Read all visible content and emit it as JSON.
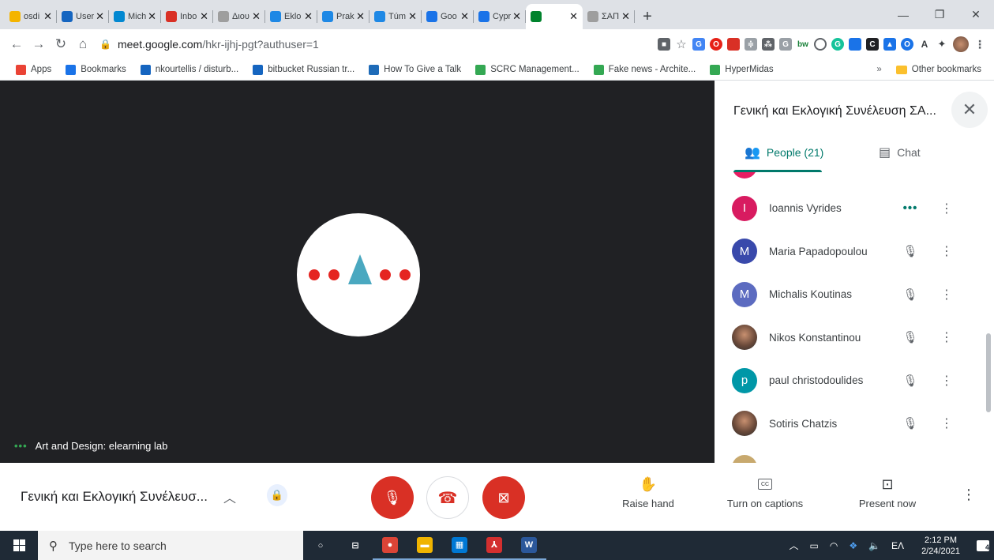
{
  "browser": {
    "tabs": [
      {
        "title": "osdi",
        "color": "#f4b400",
        "active": false
      },
      {
        "title": "User",
        "color": "#1565c0",
        "active": false
      },
      {
        "title": "Mich",
        "color": "#0288d1",
        "active": false
      },
      {
        "title": "Inbo",
        "color": "#d93025",
        "active": false
      },
      {
        "title": "Διου",
        "color": "#9e9e9e",
        "active": false
      },
      {
        "title": "Eklo",
        "color": "#1e88e5",
        "active": false
      },
      {
        "title": "Prak",
        "color": "#1e88e5",
        "active": false
      },
      {
        "title": "Túm",
        "color": "#1e88e5",
        "active": false
      },
      {
        "title": "Goo",
        "color": "#1a73e8",
        "active": false
      },
      {
        "title": "Cypr",
        "color": "#1a73e8",
        "active": false
      },
      {
        "title": "",
        "color": "#00832d",
        "active": true
      },
      {
        "title": "ΣΑΠ",
        "color": "#9e9e9e",
        "active": false
      }
    ],
    "tab_close_glyph": "✕",
    "new_tab_glyph": "+",
    "url_host": "meet.google.com",
    "url_path": "/hkr-ijhj-pgt?authuser=1",
    "bookmarks": [
      {
        "label": "Apps",
        "icon": "apps-icon",
        "color": "#ea4335"
      },
      {
        "label": "Bookmarks",
        "icon": "star-icon",
        "color": "#1a73e8"
      },
      {
        "label": "nkourtellis / disturb...",
        "icon": "bitbucket-icon",
        "color": "#1565c0"
      },
      {
        "label": "bitbucket Russian tr...",
        "icon": "atlassian-icon",
        "color": "#1565c0"
      },
      {
        "label": "How To Give a Talk",
        "icon": "page-icon",
        "color": "#1e6bb8"
      },
      {
        "label": "SCRC Management...",
        "icon": "drive-icon",
        "color": "#34a853"
      },
      {
        "label": "Fake news - Archite...",
        "icon": "drive-icon",
        "color": "#34a853"
      },
      {
        "label": "HyperMidas",
        "icon": "drive-icon",
        "color": "#34a853"
      }
    ],
    "bookmarks_overflow": "»",
    "other_bookmarks": "Other bookmarks"
  },
  "stage": {
    "presenter_label": "Art and Design: elearning lab",
    "talking_indicator": "•••",
    "logo_colors": {
      "dots": "#e52521",
      "triangle": "#4aa8c0"
    }
  },
  "panel": {
    "title": "Γενική και Εκλογική Συνέλευση ΣΑ...",
    "close_glyph": "✕",
    "people_tab": "People (21)",
    "chat_tab": "Chat",
    "accent_color": "#00796b",
    "participants": [
      {
        "name": "Ioannis Vyrides",
        "initial": "I",
        "avatar_color": "#d81b60",
        "photo": false,
        "status": "talking",
        "status_glyph": "•••"
      },
      {
        "name": "Maria Papadopoulou",
        "initial": "M",
        "avatar_color": "#3949ab",
        "photo": false,
        "status": "muted",
        "status_glyph": "🎙"
      },
      {
        "name": "Michalis Koutinas",
        "initial": "M",
        "avatar_color": "#5c6bc0",
        "photo": false,
        "status": "muted",
        "status_glyph": "🎙"
      },
      {
        "name": "Nikos Konstantinou",
        "initial": "",
        "avatar_color": "#6b4a3a",
        "photo": true,
        "status": "muted",
        "status_glyph": "🎙"
      },
      {
        "name": "paul christodoulides",
        "initial": "p",
        "avatar_color": "#0097a7",
        "photo": false,
        "status": "muted",
        "status_glyph": "🎙"
      },
      {
        "name": "Sotiris Chatzis",
        "initial": "",
        "avatar_color": "#5d4037",
        "photo": true,
        "status": "muted",
        "status_glyph": "🎙"
      }
    ],
    "more_glyph": "⋮"
  },
  "controls": {
    "meeting_name": "Γενική και Εκλογική Συνέλευσ...",
    "mic_state": "off",
    "camera_state": "off",
    "raise_hand": "Raise hand",
    "captions": "Turn on captions",
    "captions_icon_text": "CC",
    "present": "Present now",
    "more_glyph": "⋮"
  },
  "taskbar": {
    "search_placeholder": "Type here to search",
    "pinned_apps": [
      {
        "name": "cortana-icon",
        "glyph": "○",
        "color": "transparent"
      },
      {
        "name": "task-view-icon",
        "glyph": "⊟",
        "color": "transparent"
      },
      {
        "name": "chrome-icon",
        "glyph": "●",
        "color": "#db4437"
      },
      {
        "name": "file-explorer-icon",
        "glyph": "▬",
        "color": "#f0b400"
      },
      {
        "name": "store-icon",
        "glyph": "▦",
        "color": "#0078d4"
      },
      {
        "name": "acrobat-icon",
        "glyph": "⅄",
        "color": "#d32f2f"
      },
      {
        "name": "word-icon",
        "glyph": "W",
        "color": "#2b579a"
      }
    ],
    "language": "ΕΛ",
    "time": "2:12 PM",
    "date": "2/24/2021",
    "notification_count": "4"
  }
}
